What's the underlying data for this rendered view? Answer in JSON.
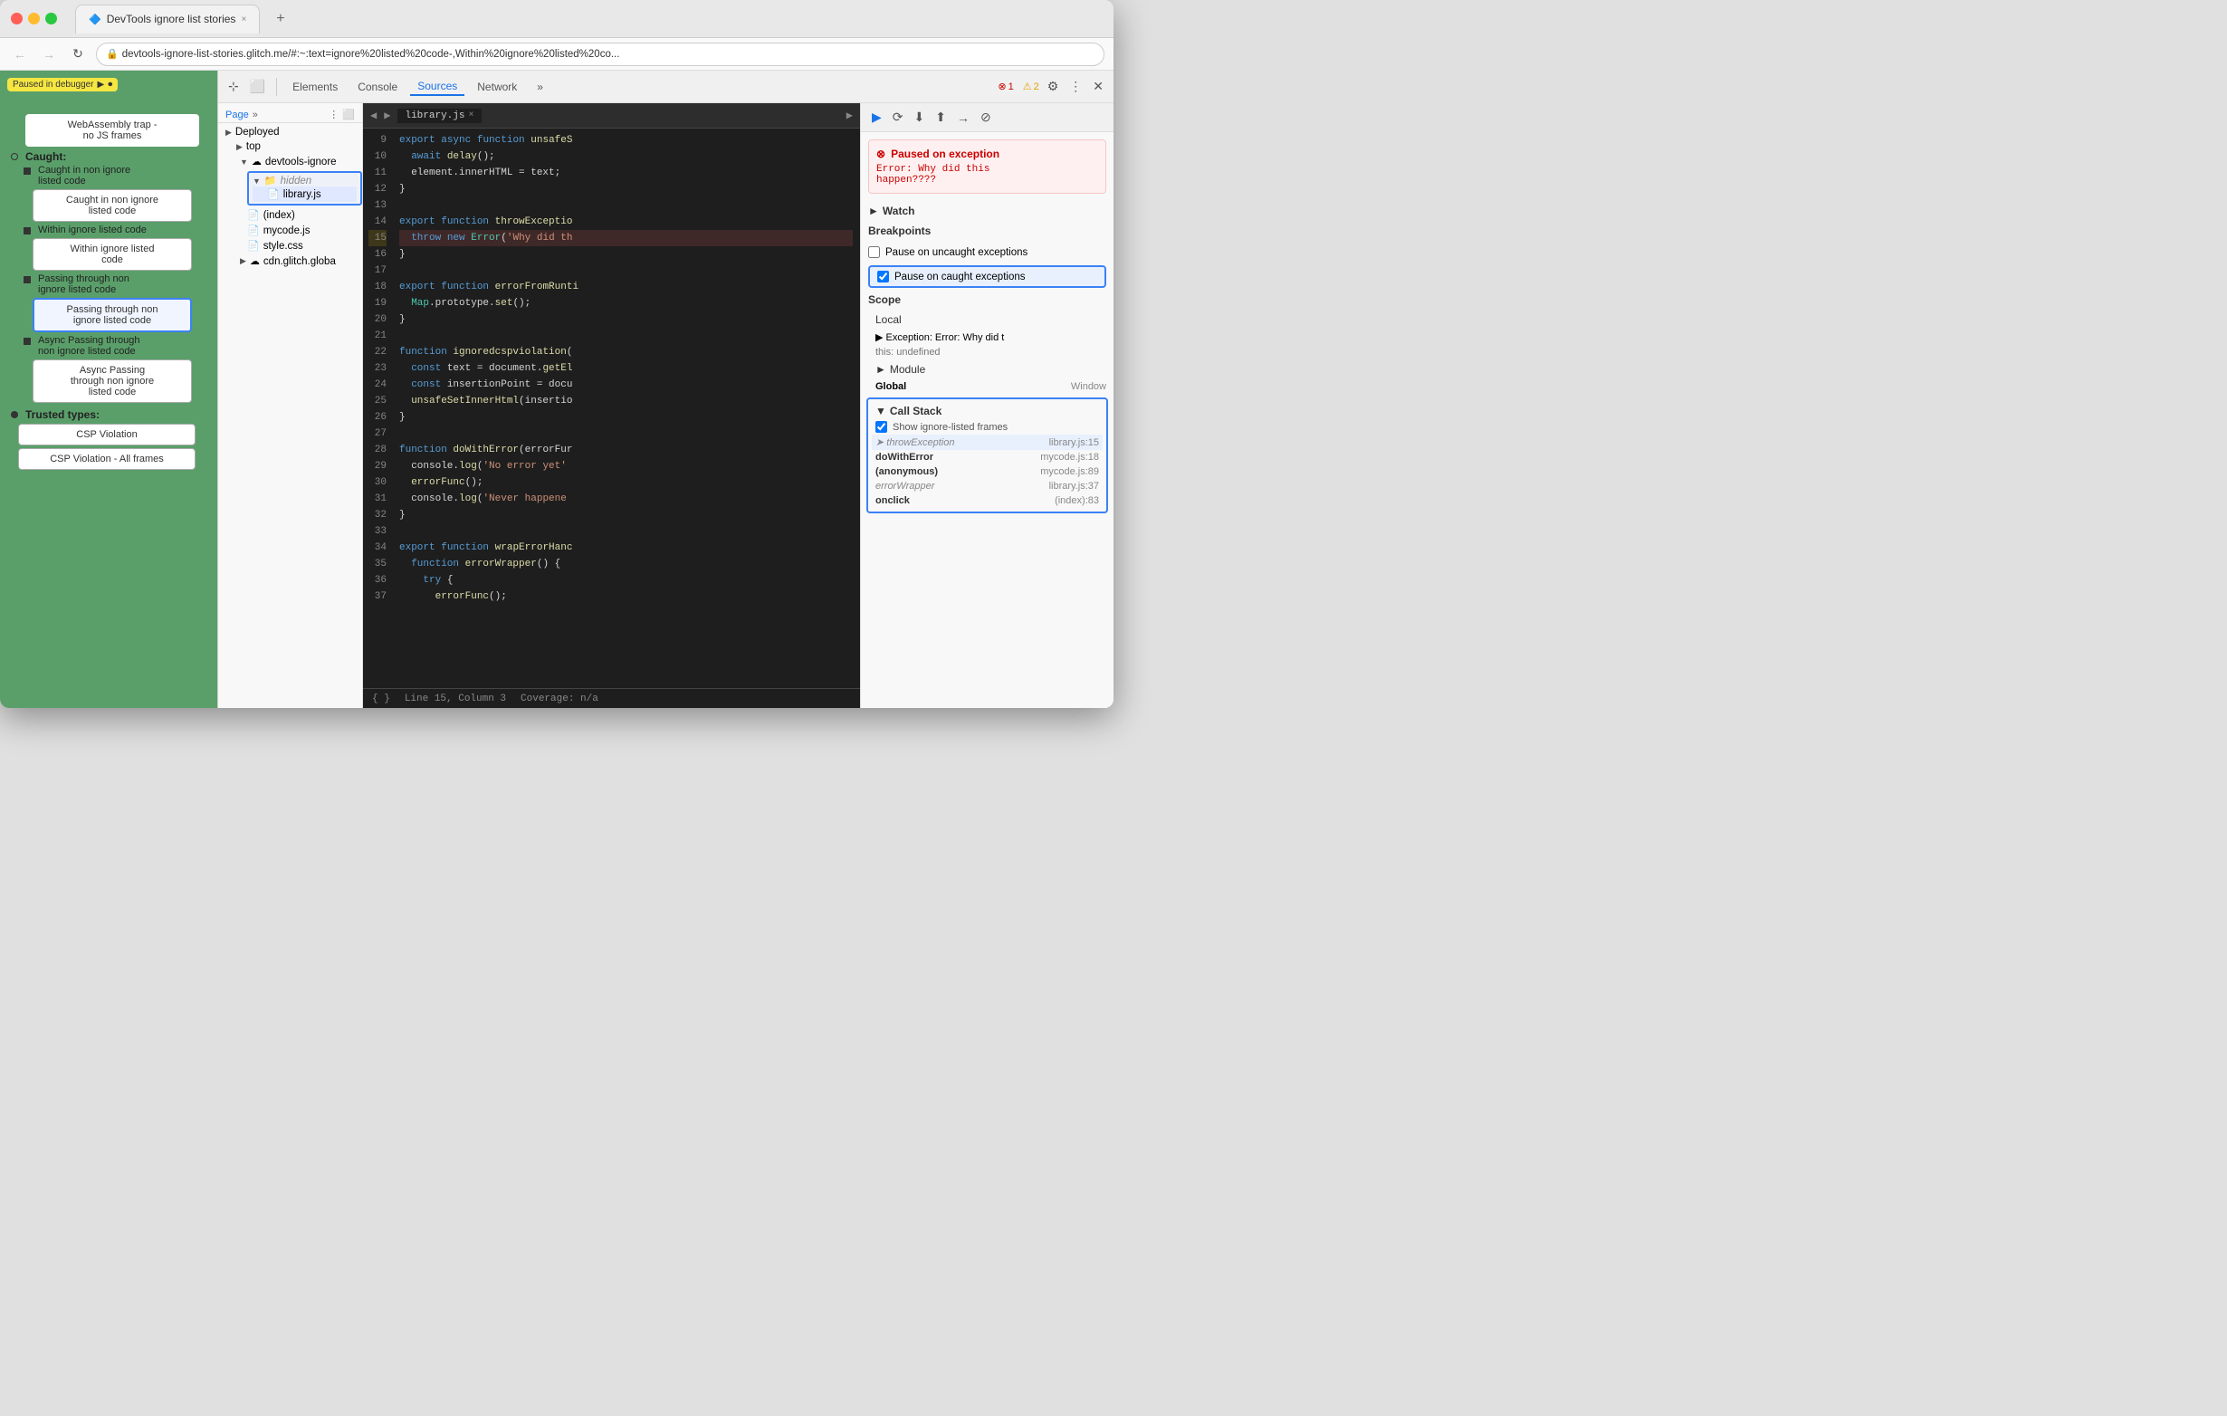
{
  "browser": {
    "traffic_lights": [
      "red",
      "yellow",
      "green"
    ],
    "tab": {
      "favicon": "🔷",
      "title": "DevTools ignore list stories",
      "close": "×"
    },
    "new_tab": "+",
    "url": "devtools-ignore-list-stories.glitch.me/#:~:text=ignore%20listed%20code-,Within%20ignore%20listed%20co...",
    "nav": {
      "back": "←",
      "forward": "→",
      "reload": "↻"
    }
  },
  "left_panel": {
    "paused_badge": "Paused in debugger",
    "webassembly": "WebAssembly trap -\nno JS frames",
    "caught_label": "Caught:",
    "items": [
      {
        "label": "Caught in non ignore\nlisted code",
        "btn": "Caught in non ignore\nlisted code",
        "active": false
      },
      {
        "label": "Within ignore listed code",
        "btn": "Within ignore listed\ncode",
        "active": false
      },
      {
        "label": "Passing through non\nignore listed code",
        "btn": "Passing through non\nignore listed code",
        "active": true
      },
      {
        "label": "Async Passing through\nnon ignore listed code",
        "btn": "Async Passing\nthrough non ignore\nlisted code",
        "active": false
      }
    ],
    "trusted_types": "Trusted types:",
    "csp_buttons": [
      "CSP Violation",
      "CSP Violation - All frames"
    ]
  },
  "devtools": {
    "toolbar_icons": [
      "⊹",
      "⬜",
      "Elements",
      "Console",
      "Sources",
      "Network",
      "»"
    ],
    "error_badge": "1",
    "warning_badge": "2",
    "tabs": [
      "Elements",
      "Console",
      "Sources",
      "Network"
    ],
    "active_tab": "Sources",
    "sources_toolbar": [
      "▶",
      "⟳",
      "⬇",
      "⬆",
      "→",
      "⊘"
    ],
    "file_tree": {
      "deployed_label": "Deployed",
      "top_label": "top",
      "devtools_ignore_label": "devtools-ignore",
      "hidden_folder": "hidden",
      "library_js": "library.js",
      "index_label": "(index)",
      "mycode_js": "mycode.js",
      "style_css": "style.css",
      "cdn_label": "cdn.glitch.globa"
    },
    "file_tab": {
      "name": "library.js",
      "close": "×"
    },
    "code": {
      "lines": [
        {
          "num": 9,
          "text": "export async function unsafeS",
          "type": "normal"
        },
        {
          "num": 10,
          "text": "  await delay();",
          "type": "normal"
        },
        {
          "num": 11,
          "text": "  element.innerHTML = text;",
          "type": "normal"
        },
        {
          "num": 12,
          "text": "}",
          "type": "normal"
        },
        {
          "num": 13,
          "text": "",
          "type": "normal"
        },
        {
          "num": 14,
          "text": "export function throwExceptio",
          "type": "highlighted"
        },
        {
          "num": 15,
          "text": "  throw new Error('Why did th",
          "type": "error-line"
        },
        {
          "num": 16,
          "text": "}",
          "type": "highlighted"
        },
        {
          "num": 17,
          "text": "",
          "type": "normal"
        },
        {
          "num": 18,
          "text": "export function errorFromRunti",
          "type": "normal"
        },
        {
          "num": 19,
          "text": "  Map.prototype.set();",
          "type": "normal"
        },
        {
          "num": 20,
          "text": "}",
          "type": "normal"
        },
        {
          "num": 21,
          "text": "",
          "type": "normal"
        },
        {
          "num": 22,
          "text": "function ignoredcspviolation(",
          "type": "normal"
        },
        {
          "num": 23,
          "text": "  const text = document.getEl",
          "type": "normal"
        },
        {
          "num": 24,
          "text": "  const insertionPoint = docu",
          "type": "normal"
        },
        {
          "num": 25,
          "text": "  unsafeSetInnerHtml(insertio",
          "type": "normal"
        },
        {
          "num": 26,
          "text": "}",
          "type": "normal"
        },
        {
          "num": 27,
          "text": "",
          "type": "normal"
        },
        {
          "num": 28,
          "text": "function doWithError(errorFur",
          "type": "normal"
        },
        {
          "num": 29,
          "text": "  console.log('No error yet'",
          "type": "normal"
        },
        {
          "num": 30,
          "text": "  errorFunc();",
          "type": "normal"
        },
        {
          "num": 31,
          "text": "  console.log('Never happene",
          "type": "normal"
        },
        {
          "num": 32,
          "text": "}",
          "type": "normal"
        },
        {
          "num": 33,
          "text": "",
          "type": "normal"
        },
        {
          "num": 34,
          "text": "export function wrapErrorHanc",
          "type": "normal"
        },
        {
          "num": 35,
          "text": "  function errorWrapper() {",
          "type": "normal"
        },
        {
          "num": 36,
          "text": "    try {",
          "type": "normal"
        },
        {
          "num": 37,
          "text": "      errorFunc();",
          "type": "normal"
        }
      ],
      "status_line": "Line 15, Column 3",
      "coverage": "Coverage: n/a"
    }
  },
  "right_panel": {
    "toolbar_btns": [
      "▶",
      "⟳",
      "⬇",
      "⬆",
      "→"
    ],
    "exception": {
      "title": "Paused on exception",
      "error_icon": "⊗",
      "message": "Error: Why did this\nhappen????"
    },
    "watch_label": "Watch",
    "breakpoints_label": "Breakpoints",
    "pause_uncaught": "Pause on uncaught exceptions",
    "pause_caught": "Pause on caught exceptions",
    "scope_label": "Scope",
    "local_label": "Local",
    "exception_scope": "▶ Exception: Error: Why did t",
    "this_scope": "this: undefined",
    "module_label": "Module",
    "global_label": "Global",
    "global_value": "Window",
    "call_stack_label": "Call Stack",
    "show_ignore": "Show ignore-listed frames",
    "frames": [
      {
        "name": "throwException",
        "loc": "library.js:15",
        "dimmed": true,
        "active": true
      },
      {
        "name": "doWithError",
        "loc": "mycode.js:18",
        "dimmed": false,
        "active": false
      },
      {
        "name": "(anonymous)",
        "loc": "mycode.js:89",
        "dimmed": false,
        "active": false
      },
      {
        "name": "errorWrapper",
        "loc": "library.js:37",
        "dimmed": true,
        "active": false
      },
      {
        "name": "onclick",
        "loc": "(index):83",
        "dimmed": false,
        "active": false
      }
    ]
  }
}
